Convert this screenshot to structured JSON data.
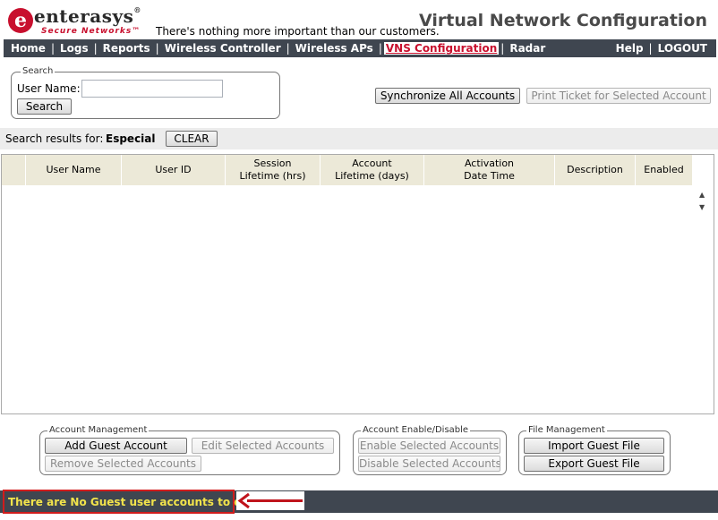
{
  "header": {
    "brand": "enterasys",
    "brand_mark": "®",
    "brand_sub": "Secure Networks",
    "brand_sub_mark": "™",
    "tagline": "There's nothing more important than our customers.",
    "page_title": "Virtual Network Configuration"
  },
  "nav": {
    "items": [
      {
        "label": "Home"
      },
      {
        "label": "Logs"
      },
      {
        "label": "Reports"
      },
      {
        "label": "Wireless Controller"
      },
      {
        "label": "Wireless APs"
      },
      {
        "label": "VNS Configuration",
        "active": true
      },
      {
        "label": "Radar"
      }
    ],
    "right": [
      {
        "label": "Help"
      },
      {
        "label": "LOGOUT"
      }
    ],
    "separator": "|"
  },
  "search": {
    "legend": "Search",
    "user_name_label": "User Name:",
    "user_name_value": "",
    "search_button": "Search"
  },
  "actions": {
    "sync_all": "Synchronize All Accounts",
    "print_ticket": "Print Ticket for Selected Account"
  },
  "results": {
    "label": "Search results for:",
    "term": "Especial",
    "clear_button": "CLEAR"
  },
  "table": {
    "columns": [
      {
        "label": ""
      },
      {
        "label": "User Name"
      },
      {
        "label": "User ID"
      },
      {
        "label": "Session\nLifetime (hrs)"
      },
      {
        "label": "Account\nLifetime (days)"
      },
      {
        "label": "Activation\nDate Time"
      },
      {
        "label": "Description"
      },
      {
        "label": "Enabled"
      }
    ],
    "rows": []
  },
  "account_management": {
    "legend": "Account Management",
    "add_guest": "Add Guest Account",
    "edit_selected": "Edit Selected Accounts",
    "remove_selected": "Remove Selected Accounts"
  },
  "enable_disable": {
    "legend": "Account Enable/Disable",
    "enable_selected": "Enable Selected Accounts",
    "disable_selected": "Disable Selected Accounts"
  },
  "file_management": {
    "legend": "File Management",
    "import_file": "Import Guest File",
    "export_file": "Export Guest File"
  },
  "status": {
    "message": "There are No Guest user accounts to display."
  },
  "colors": {
    "nav_bg": "#3f4650",
    "brand_red": "#c8102e",
    "status_text": "#f2e44b",
    "highlight_border": "#d01c1c",
    "annotation_arrow": "#c0141c"
  }
}
